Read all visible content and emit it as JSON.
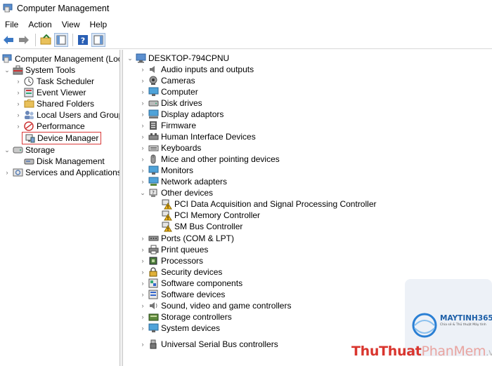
{
  "window": {
    "title": "Computer Management"
  },
  "menu": [
    "File",
    "Action",
    "View",
    "Help"
  ],
  "toolbar": {
    "icons": [
      "back-arrow-icon",
      "forward-arrow-icon",
      "up-folder-icon",
      "show-console-tree-icon",
      "help-icon",
      "show-action-pane-icon"
    ]
  },
  "left_tree": {
    "root": "Computer Management (Local)",
    "system_tools": "System Tools",
    "task_scheduler": "Task Scheduler",
    "event_viewer": "Event Viewer",
    "shared_folders": "Shared Folders",
    "local_users": "Local Users and Groups",
    "performance": "Performance",
    "device_manager": "Device Manager",
    "storage": "Storage",
    "disk_management": "Disk Management",
    "services": "Services and Applications"
  },
  "device_tree": {
    "computer_name": "DESKTOP-794CPNU",
    "categories": [
      "Audio inputs and outputs",
      "Cameras",
      "Computer",
      "Disk drives",
      "Display adaptors",
      "Firmware",
      "Human Interface Devices",
      "Keyboards",
      "Mice and other pointing devices",
      "Monitors",
      "Network adapters",
      "Other devices"
    ],
    "other_devices": [
      "PCI Data Acquisition and Signal Processing Controller",
      "PCI Memory Controller",
      "SM Bus Controller"
    ],
    "categories_after": [
      "Ports (COM & LPT)",
      "Print queues",
      "Processors",
      "Security devices",
      "Software components",
      "Software devices",
      "Sound, video and game controllers",
      "Storage controllers",
      "System devices",
      "Universal Serial Bus controllers"
    ]
  },
  "watermark": {
    "brand": "MAYTINH365",
    "tagline": "Chia sẻ & Thủ thuật Máy tính",
    "text_red": "ThuThuat",
    "text_pink": "PhanMem",
    "text_tld": ".vn"
  }
}
